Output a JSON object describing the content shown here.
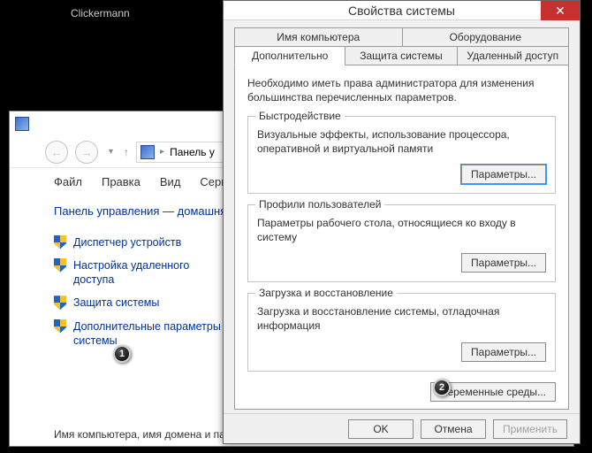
{
  "desktop": {
    "app_label": "Clickermann"
  },
  "explorer": {
    "breadcrumb": "Панель у",
    "menu": {
      "file": "Файл",
      "edit": "Правка",
      "view": "Вид",
      "service": "Сервис"
    },
    "home": "Панель управления — домашняя страница",
    "items": [
      "Диспетчер устройств",
      "Настройка удаленного доступа",
      "Защита системы",
      "Дополнительные параметры системы"
    ],
    "footer": "Имя компьютера, имя домена и параметры рабочей группы"
  },
  "dialog": {
    "title": "Свойства системы",
    "tabs_row1": [
      "Имя компьютера",
      "Оборудование"
    ],
    "tabs_row2": [
      "Дополнительно",
      "Защита системы",
      "Удаленный доступ"
    ],
    "intro": "Необходимо иметь права администратора для изменения большинства перечисленных параметров.",
    "groups": {
      "perf": {
        "legend": "Быстродействие",
        "desc": "Визуальные эффекты, использование процессора, оперативной и виртуальной памяти",
        "btn": "Параметры..."
      },
      "prof": {
        "legend": "Профили пользователей",
        "desc": "Параметры рабочего стола, относящиеся ко входу в систему",
        "btn": "Параметры..."
      },
      "boot": {
        "legend": "Загрузка и восстановление",
        "desc": "Загрузка и восстановление системы, отладочная информация",
        "btn": "Параметры..."
      }
    },
    "env_btn": "Переменные среды...",
    "footer": {
      "ok": "OK",
      "cancel": "Отмена",
      "apply": "Применить"
    }
  },
  "badges": {
    "one": "1",
    "two": "2"
  }
}
